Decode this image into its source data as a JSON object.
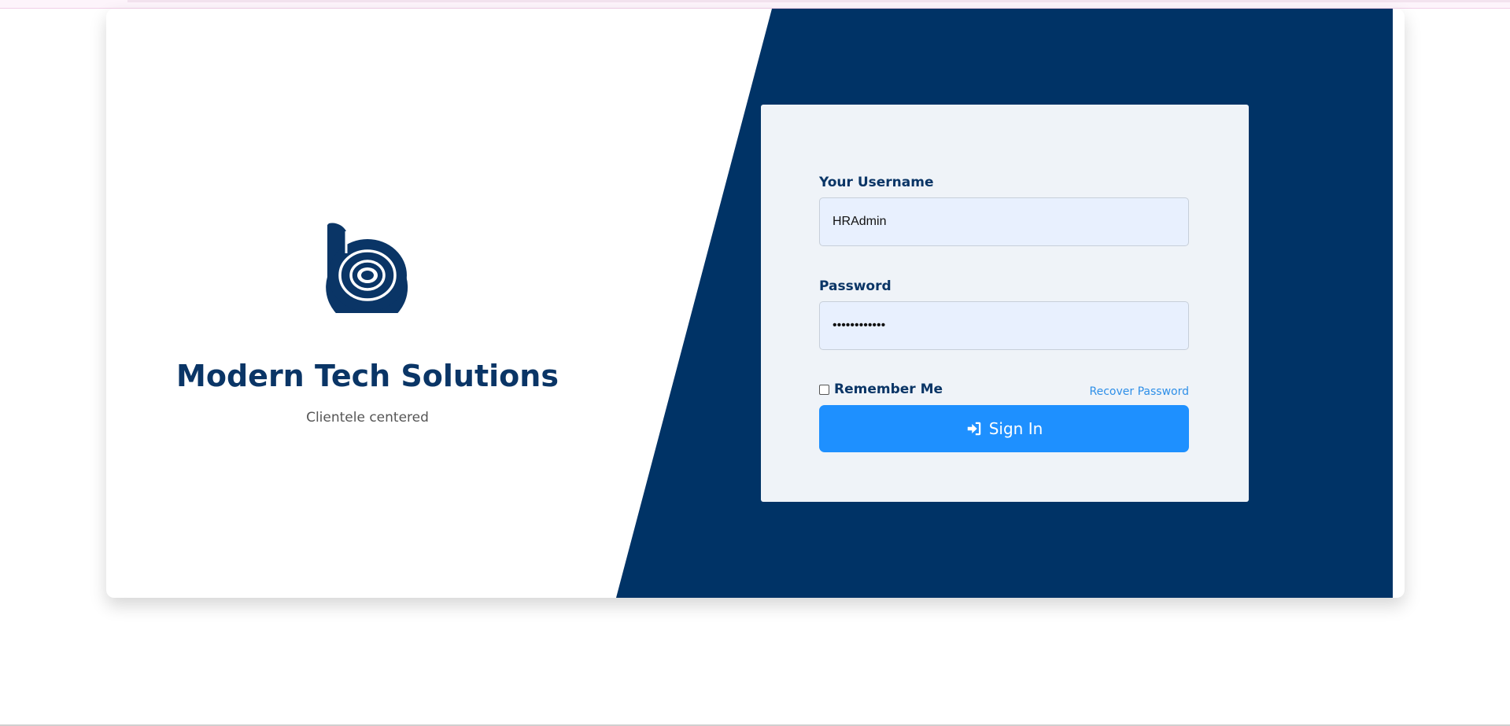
{
  "brand": {
    "logo_icon": "b-spiral-logo-icon",
    "company_name": "Modern Tech Solutions",
    "tagline": "Clientele centered"
  },
  "login": {
    "username_label": "Your Username",
    "username_value": "HRAdmin",
    "password_label": "Password",
    "password_value": "••••••••••••",
    "remember_label": "Remember Me",
    "remember_checked": false,
    "recover_label": "Recover Password",
    "signin_label": "Sign In",
    "signin_icon": "sign-in-icon"
  },
  "colors": {
    "navy": "#003366",
    "brand_text": "#0a3566",
    "accent": "#1e90ff",
    "link": "#2e8fe8",
    "form_bg": "#eff3f8",
    "input_bg": "#e8f0fe"
  }
}
